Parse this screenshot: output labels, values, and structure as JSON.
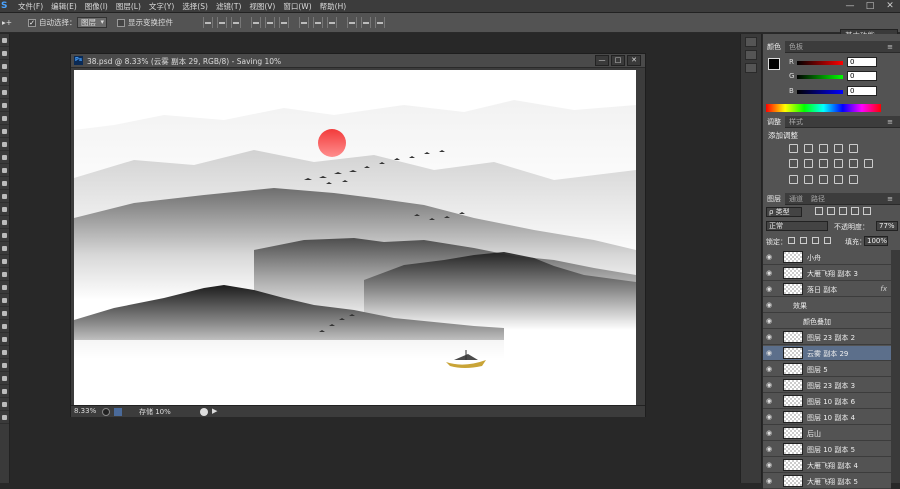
{
  "app": {
    "logo": "S",
    "window_controls": [
      "—",
      "□",
      "✕"
    ]
  },
  "menu": [
    "文件(F)",
    "编辑(E)",
    "图像(I)",
    "图层(L)",
    "文字(Y)",
    "选择(S)",
    "滤镜(T)",
    "视图(V)",
    "窗口(W)",
    "帮助(H)"
  ],
  "options": {
    "tool_icon": "▸+",
    "auto_select_label": "自动选择：",
    "auto_select_checked": "✓",
    "auto_select_target": "图层",
    "show_transform_label": "显示变换控件"
  },
  "workspace": "基本功能",
  "document": {
    "title": "38.psd @ 8.33% (云雾 副本 29, RGB/8) - Saving 10%",
    "zoom": "8.33%",
    "status": "存储 10%",
    "play": "▶",
    "controls": [
      "—",
      "□",
      "✕"
    ]
  },
  "color_panel": {
    "tabs": [
      "颜色",
      "色板"
    ],
    "channels": [
      {
        "label": "R",
        "value": "0"
      },
      {
        "label": "G",
        "value": "0"
      },
      {
        "label": "B",
        "value": "0"
      }
    ]
  },
  "adjust_panel": {
    "tabs": [
      "调整",
      "样式"
    ],
    "add_label": "添加调整"
  },
  "layers_panel": {
    "tabs": [
      "图层",
      "通道",
      "路径"
    ],
    "filter_kind": "ρ 类型",
    "blend_mode": "正常",
    "opacity_label": "不透明度：",
    "opacity_value": "77%",
    "lock_label": "锁定：",
    "fill_label": "填充：",
    "fill_value": "100%",
    "layers": [
      {
        "name": "小舟",
        "visible": "◉"
      },
      {
        "name": "大雁飞翔 副本 3",
        "visible": "◉"
      },
      {
        "name": "落日 副本",
        "visible": "◉",
        "fx": "fx"
      },
      {
        "name": "效果",
        "visible": "◉",
        "sub": 1
      },
      {
        "name": "颜色叠加",
        "visible": "◉",
        "sub": 2
      },
      {
        "name": "图层 23 副本 2",
        "visible": "◉"
      },
      {
        "name": "云雾 副本 29",
        "visible": "◉",
        "selected": true
      },
      {
        "name": "图层 5",
        "visible": "◉"
      },
      {
        "name": "图层 23 副本 3",
        "visible": "◉"
      },
      {
        "name": "图层 10 副本 6",
        "visible": "◉"
      },
      {
        "name": "图层 10 副本 4",
        "visible": "◉"
      },
      {
        "name": "后山",
        "visible": "◉"
      },
      {
        "name": "图层 10 副本 5",
        "visible": "◉"
      },
      {
        "name": "大雁飞翔 副本 4",
        "visible": "◉"
      },
      {
        "name": "大雁飞翔 副本 5",
        "visible": "◉"
      }
    ]
  },
  "colors": {
    "sun": "#ee3a3a",
    "boat": "#c9a437",
    "selected_layer": "#5c6f8b"
  }
}
